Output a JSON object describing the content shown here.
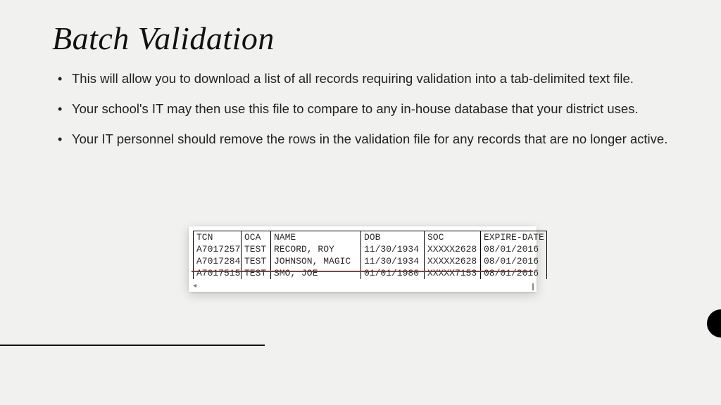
{
  "title": "Batch Validation",
  "bullets": [
    "This will allow you to download a list of all records requiring validation into a tab-delimited text file.",
    "Your school's IT may then use this file to compare to any in-house database that your district uses.",
    "Your IT personnel should remove the rows in the validation file for any records that are no longer active."
  ],
  "table": {
    "headers": {
      "tcn": "TCN",
      "oca": "OCA",
      "name": "NAME",
      "dob": "DOB",
      "soc": "SOC",
      "expire": "EXPIRE-DATE"
    },
    "rows": [
      {
        "tcn": "A7017257",
        "oca": "TEST",
        "name": "RECORD, ROY",
        "dob": "11/30/1934",
        "soc": "XXXXX2628",
        "expire": "08/01/2016"
      },
      {
        "tcn": "A7017284",
        "oca": "TEST",
        "name": "JOHNSON, MAGIC",
        "dob": "11/30/1934",
        "soc": "XXXXX2628",
        "expire": "08/01/2016"
      },
      {
        "tcn": "A7017515",
        "oca": "TEST",
        "name": "SMO, JOE",
        "dob": "01/01/1980",
        "soc": "XXXXX7153",
        "expire": "08/01/2016"
      }
    ]
  }
}
